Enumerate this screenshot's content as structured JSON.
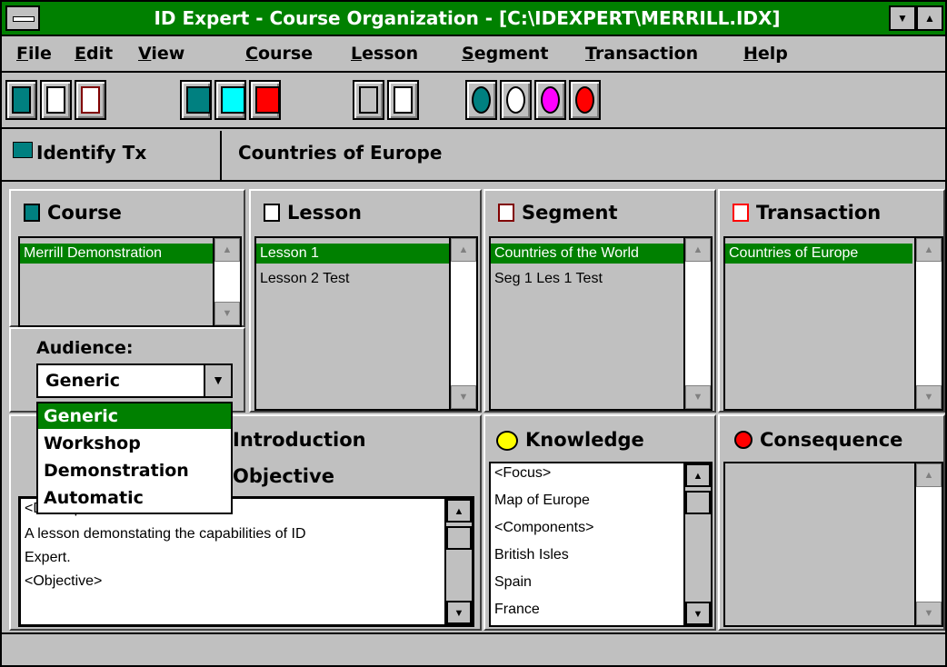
{
  "window": {
    "title": "ID Expert - Course Organization - [C:\\IDEXPERT\\MERRILL.IDX]"
  },
  "menu": [
    "File",
    "Edit",
    "View",
    "Course",
    "Lesson",
    "Segment",
    "Transaction",
    "Help"
  ],
  "toolbar": {
    "buttons": [
      "course-book-icon",
      "lesson-book-icon",
      "segment-book-icon",
      "identify-tx-icon",
      "execute-tx-icon",
      "interpret-tx-icon",
      "edit-knowledge-icon",
      "chart-icon",
      "globe-search-1-icon",
      "globe-search-2-icon",
      "globe-search-3-icon",
      "globe-search-4-icon"
    ]
  },
  "transaction_bar": {
    "type_label": "Identify Tx",
    "name": "Countries of Europe"
  },
  "course_panel": {
    "title": "Course",
    "items": [
      "Merrill Demonstration"
    ],
    "selected": 0,
    "audience_label": "Audience:",
    "audience_value": "Generic",
    "audience_options": [
      "Generic",
      "Workshop",
      "Demonstration",
      "Automatic"
    ]
  },
  "lesson_panel": {
    "title": "Lesson",
    "items": [
      "Lesson 1",
      "Lesson 2 Test"
    ],
    "selected": 0
  },
  "segment_panel": {
    "title": "Segment",
    "items": [
      "Countries of the World",
      "Seg 1 Les 1 Test"
    ],
    "selected": 0
  },
  "transaction_panel": {
    "title": "Transaction",
    "items": [
      "Countries of Europe"
    ],
    "selected": 0
  },
  "intro_panel": {
    "title_introduction": "Introduction",
    "title_objective": "Objective",
    "text_lines": [
      "<Description>",
      "A lesson demonstating the capabilities of ID",
      "Expert.",
      "<Objective>"
    ]
  },
  "knowledge_panel": {
    "title": "Knowledge",
    "items": [
      "<Focus>",
      "Map of Europe",
      "<Components>",
      "British Isles",
      "Spain",
      "France"
    ]
  },
  "consequence_panel": {
    "title": "Consequence"
  },
  "colors": {
    "accent": "#008000",
    "background": "#c0c0c0"
  }
}
